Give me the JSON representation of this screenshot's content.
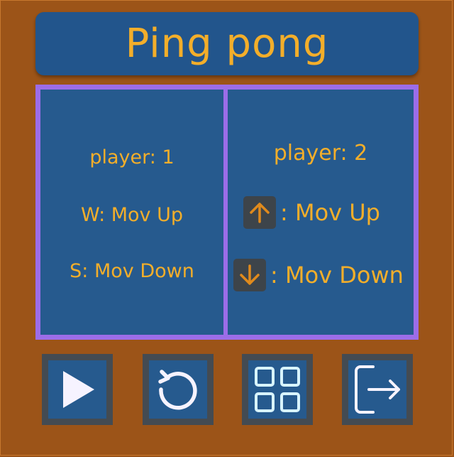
{
  "title": "Ping pong",
  "colors": {
    "background": "#9c5418",
    "panel": "#265a8e",
    "panel_border": "#9c6de8",
    "text": "#f3ae2a",
    "button_frame": "#444b52",
    "key_cap": "#3d444a",
    "arrow": "#e08a1c"
  },
  "player1": {
    "name": "player: 1",
    "up": "W: Mov Up",
    "down": "S: Mov Down"
  },
  "player2": {
    "name": "player: 2",
    "up_label": ": Mov Up",
    "down_label": ": Mov Down",
    "up_key_icon": "arrow-up-icon",
    "down_key_icon": "arrow-down-icon"
  },
  "buttons": [
    {
      "name": "play-button",
      "icon": "play-icon"
    },
    {
      "name": "restart-button",
      "icon": "restart-icon"
    },
    {
      "name": "menu-button",
      "icon": "grid-icon"
    },
    {
      "name": "exit-button",
      "icon": "exit-icon"
    }
  ]
}
